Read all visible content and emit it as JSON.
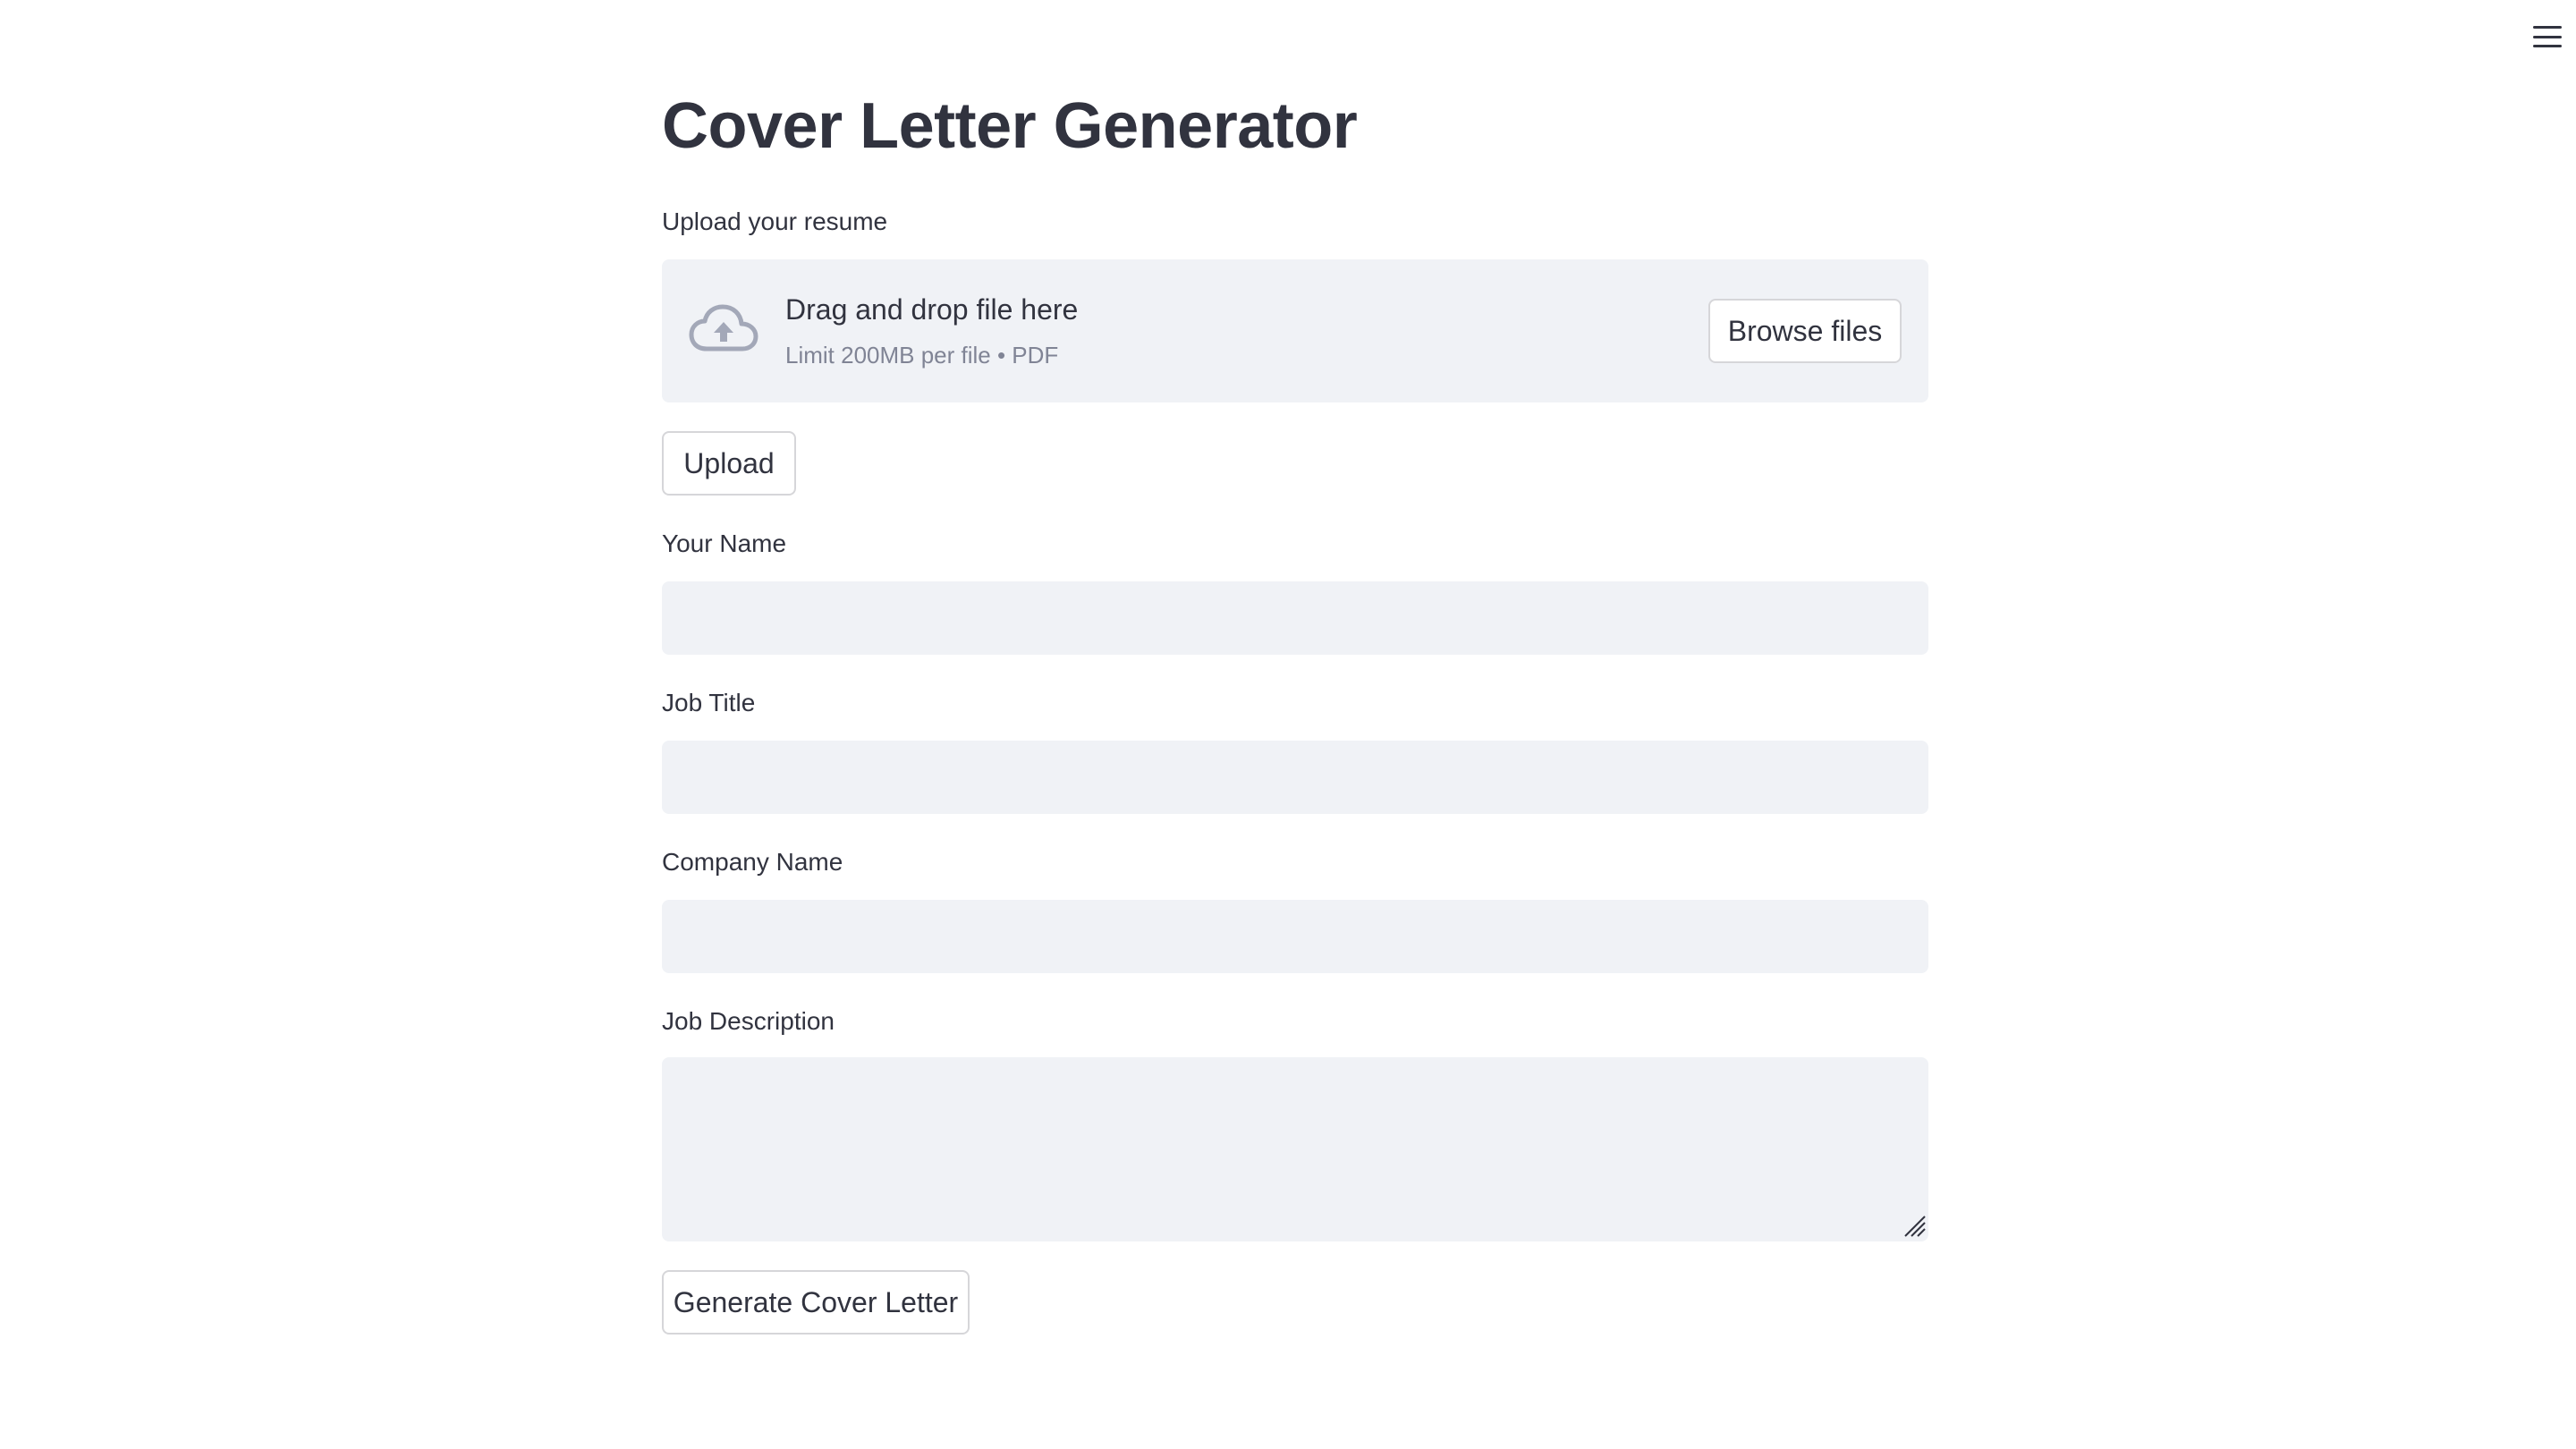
{
  "header": {
    "menu_icon": "hamburger-menu-icon"
  },
  "main": {
    "title": "Cover Letter Generator",
    "uploader": {
      "label": "Upload your resume",
      "icon": "cloud-upload-icon",
      "drop_text": "Drag and drop file here",
      "limit_text": "Limit 200MB per file • PDF",
      "browse_label": "Browse files"
    },
    "upload_button_label": "Upload",
    "fields": {
      "your_name": {
        "label": "Your Name",
        "value": ""
      },
      "job_title": {
        "label": "Job Title",
        "value": ""
      },
      "company_name": {
        "label": "Company Name",
        "value": ""
      },
      "job_description": {
        "label": "Job Description",
        "value": ""
      }
    },
    "generate_button_label": "Generate Cover Letter"
  },
  "colors": {
    "text": "#31333f",
    "muted": "#808495",
    "field_background": "#f0f2f6",
    "button_border": "#d6d6d9",
    "icon": "#a3a8b8"
  }
}
